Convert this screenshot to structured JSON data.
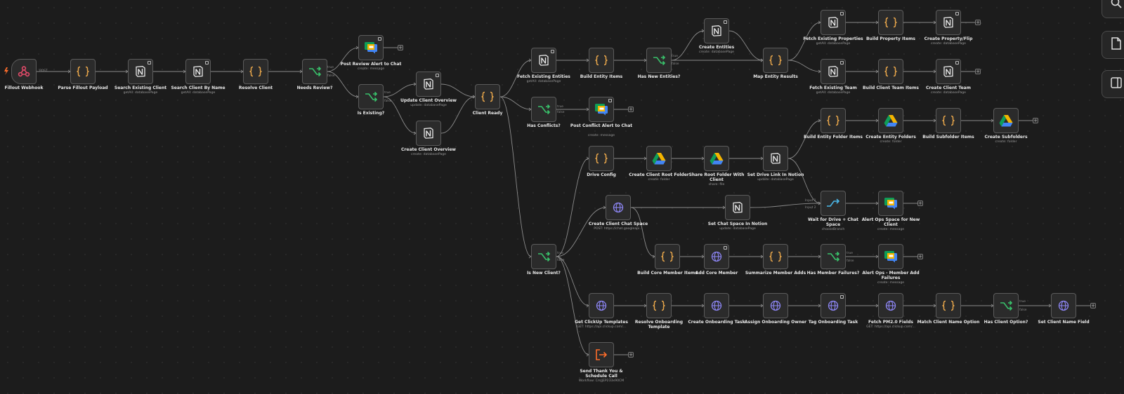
{
  "canvas": {
    "background": "#1c1c1c",
    "toolbar": [
      {
        "name": "search-button",
        "icon": "search-icon"
      },
      {
        "name": "sticky-note-button",
        "icon": "sticky-note-icon"
      },
      {
        "name": "panel-toggle-button",
        "icon": "panel-icon"
      }
    ]
  },
  "colors": {
    "notion": "#e8e8e8",
    "code": "#e8a64b",
    "if": "#39c06a",
    "http": "#8d86f4",
    "webhook": "#e54b6a",
    "drive_blue": "#4285f4",
    "drive_green": "#0f9d58",
    "drive_yellow": "#f4b400",
    "exec": "#ff6d2b",
    "wait": "#4bb7e8"
  },
  "nodes": [
    {
      "id": "n1",
      "label": "Fillout Webhook",
      "sub": "",
      "icon": "webhook"
    },
    {
      "id": "n2",
      "label": "Parse Fillout Payload",
      "sub": "",
      "icon": "code"
    },
    {
      "id": "n3",
      "label": "Search Existing Client",
      "sub": "getAll: databasePage",
      "icon": "notion"
    },
    {
      "id": "n4",
      "label": "Search Client By Name",
      "sub": "getAll: databasePage",
      "icon": "notion"
    },
    {
      "id": "n5",
      "label": "Resolve Client",
      "sub": "",
      "icon": "code"
    },
    {
      "id": "n6",
      "label": "Needs Review?",
      "sub": "",
      "icon": "if"
    },
    {
      "id": "n7",
      "label": "Post Review Alert to Chat",
      "sub": "create: message",
      "icon": "chat"
    },
    {
      "id": "n8",
      "label": "Is Existing?",
      "sub": "",
      "icon": "if"
    },
    {
      "id": "n9",
      "label": "Update Client Overview",
      "sub": "update: databasePage",
      "icon": "notion"
    },
    {
      "id": "n10",
      "label": "Create Client Overview",
      "sub": "create: databasePage",
      "icon": "notion"
    },
    {
      "id": "n11",
      "label": "Client Ready",
      "sub": "",
      "icon": "code"
    },
    {
      "id": "n12",
      "label": "Fetch Existing Entities",
      "sub": "getAll: databasePage",
      "icon": "notion"
    },
    {
      "id": "n13",
      "label": "Build Entity Items",
      "sub": "",
      "icon": "code"
    },
    {
      "id": "n14",
      "label": "Has New Entities?",
      "sub": "",
      "icon": "if"
    },
    {
      "id": "n15",
      "label": "Create Entities",
      "sub": "create: databasePage",
      "icon": "notion"
    },
    {
      "id": "n16",
      "label": "Map Entity Results",
      "sub": "",
      "icon": "code"
    },
    {
      "id": "n17",
      "label": "Fetch Existing Properties",
      "sub": "getAll: databasePage",
      "icon": "notion"
    },
    {
      "id": "n18",
      "label": "Build Property Items",
      "sub": "",
      "icon": "code"
    },
    {
      "id": "n19",
      "label": "Create Property/Flip",
      "sub": "create: databasePage",
      "icon": "notion"
    },
    {
      "id": "n20",
      "label": "Fetch Existing Team",
      "sub": "getAll: databasePage",
      "icon": "notion"
    },
    {
      "id": "n21",
      "label": "Build Client Team Items",
      "sub": "",
      "icon": "code"
    },
    {
      "id": "n22",
      "label": "Create Client Team",
      "sub": "create: databasePage",
      "icon": "notion"
    },
    {
      "id": "n23",
      "label": "Has Conflicts?",
      "sub": "",
      "icon": "if"
    },
    {
      "id": "n24",
      "label": "Post Conflict Alert to Chat",
      "sub": "create: message",
      "icon": "chat"
    },
    {
      "id": "n25",
      "label": "Build Entity Folder Items",
      "sub": "",
      "icon": "code"
    },
    {
      "id": "n26",
      "label": "Create Entity Folders",
      "sub": "create: folder",
      "icon": "drive"
    },
    {
      "id": "n27",
      "label": "Build Subfolder Items",
      "sub": "",
      "icon": "code"
    },
    {
      "id": "n28",
      "label": "Create Subfolders",
      "sub": "create: folder",
      "icon": "drive"
    },
    {
      "id": "n29",
      "label": "Drive Config",
      "sub": "",
      "icon": "code"
    },
    {
      "id": "n30",
      "label": "Create Client Root Folder",
      "sub": "create: folder",
      "icon": "drive"
    },
    {
      "id": "n31",
      "label": "Share Root Folder With Client",
      "sub": "share: file",
      "icon": "drive"
    },
    {
      "id": "n32",
      "label": "Set Drive Link In Notion",
      "sub": "update: databasePage",
      "icon": "notion"
    },
    {
      "id": "n33",
      "label": "Create Client Chat Space",
      "sub": "POST: https://chat.googleapi...",
      "icon": "http"
    },
    {
      "id": "n34",
      "label": "Set Chat Space In Notion",
      "sub": "update: databasePage",
      "icon": "notion"
    },
    {
      "id": "n35",
      "label": "Wait for Drive + Chat Space",
      "sub": "chooseBranch",
      "icon": "wait"
    },
    {
      "id": "n36",
      "label": "Alert Ops Space for New Client",
      "sub": "create: message",
      "icon": "chat"
    },
    {
      "id": "n37",
      "label": "Is New Client?",
      "sub": "",
      "icon": "if"
    },
    {
      "id": "n38",
      "label": "Build Core Member Items",
      "sub": "",
      "icon": "code"
    },
    {
      "id": "n39",
      "label": "Add Core Member",
      "sub": "",
      "icon": "http"
    },
    {
      "id": "n40",
      "label": "Summarize Member Adds",
      "sub": "",
      "icon": "code"
    },
    {
      "id": "n41",
      "label": "Has Member Failures?",
      "sub": "",
      "icon": "if"
    },
    {
      "id": "n42",
      "label": "Alert Ops - Member Add Failures",
      "sub": "create: message",
      "icon": "chat"
    },
    {
      "id": "n43",
      "label": "Get ClickUp Templates",
      "sub": "GET: https://api.clickup.com/...",
      "icon": "http"
    },
    {
      "id": "n44",
      "label": "Resolve Onboarding Template",
      "sub": "",
      "icon": "code"
    },
    {
      "id": "n45",
      "label": "Create Onboarding Task",
      "sub": "",
      "icon": "http"
    },
    {
      "id": "n46",
      "label": "Assign Onboarding Owner",
      "sub": "",
      "icon": "http"
    },
    {
      "id": "n47",
      "label": "Tag Onboarding Task",
      "sub": "",
      "icon": "http"
    },
    {
      "id": "n48",
      "label": "Fetch PM2.0 Fields",
      "sub": "GET: https://api.clickup.com/...",
      "icon": "http"
    },
    {
      "id": "n49",
      "label": "Match Client Name Option",
      "sub": "",
      "icon": "code"
    },
    {
      "id": "n50",
      "label": "Has Client Option?",
      "sub": "",
      "icon": "if"
    },
    {
      "id": "n51",
      "label": "Set Client Name Field",
      "sub": "",
      "icon": "http"
    },
    {
      "id": "n52",
      "label": "Send Thank You & Schedule Call",
      "sub": "Workflow: CmJjEP233x90CM",
      "icon": "exec"
    }
  ],
  "edge_labels": [
    {
      "id": "e_post",
      "text": "POST"
    },
    {
      "id": "e_true1",
      "text": "true"
    },
    {
      "id": "e_false1",
      "text": "false"
    },
    {
      "id": "e_true2",
      "text": "true"
    },
    {
      "id": "e_false2",
      "text": "false"
    },
    {
      "id": "e_true3",
      "text": "true"
    },
    {
      "id": "e_false3",
      "text": "false"
    },
    {
      "id": "e_true4",
      "text": "true"
    },
    {
      "id": "e_false4",
      "text": "false"
    },
    {
      "id": "e_input1",
      "text": "Input 1"
    },
    {
      "id": "e_input2",
      "text": "Input 2"
    },
    {
      "id": "e_true5",
      "text": "true"
    },
    {
      "id": "e_false5",
      "text": "false"
    },
    {
      "id": "e_true6",
      "text": "true"
    },
    {
      "id": "e_false6",
      "text": "false"
    },
    {
      "id": "e_true7",
      "text": "true"
    },
    {
      "id": "e_false7",
      "text": "false"
    }
  ]
}
